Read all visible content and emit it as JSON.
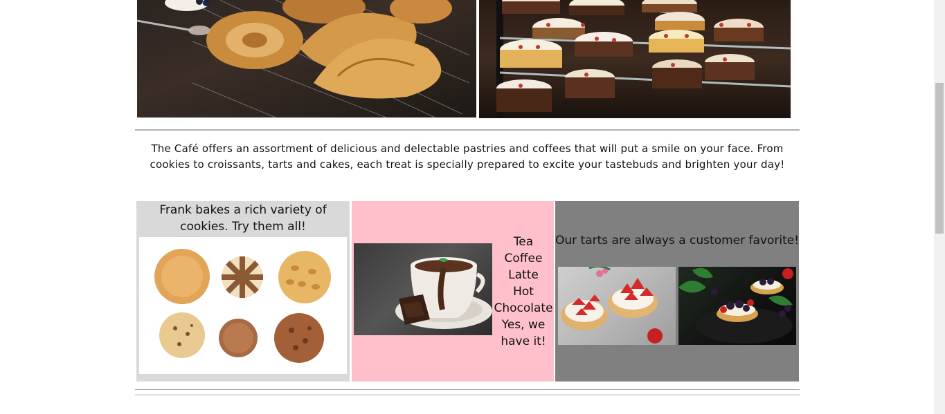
{
  "hero": {
    "pastry_image_alt": "pastries",
    "cakes_image_alt": "cakes"
  },
  "intro": {
    "text": "The Café offers an assortment of delicious and delectable pastries and coffees that will put a smile on your face. From cookies to croissants, tarts and cakes, each treat is specially prepared to excite your tastebuds and brighten your day!"
  },
  "cookies": {
    "caption": "Frank bakes a rich variety of cookies. Try them all!"
  },
  "drinks": {
    "items": [
      "Tea",
      "Coffee",
      "Latte",
      "Hot Chocolate",
      "Yes, we have it!"
    ]
  },
  "tarts": {
    "caption": "Our tarts are always a customer favorite!"
  },
  "colors": {
    "cookies_bg": "#d9d9d9",
    "drinks_bg": "#ffc0cb",
    "tarts_bg": "#808080"
  }
}
